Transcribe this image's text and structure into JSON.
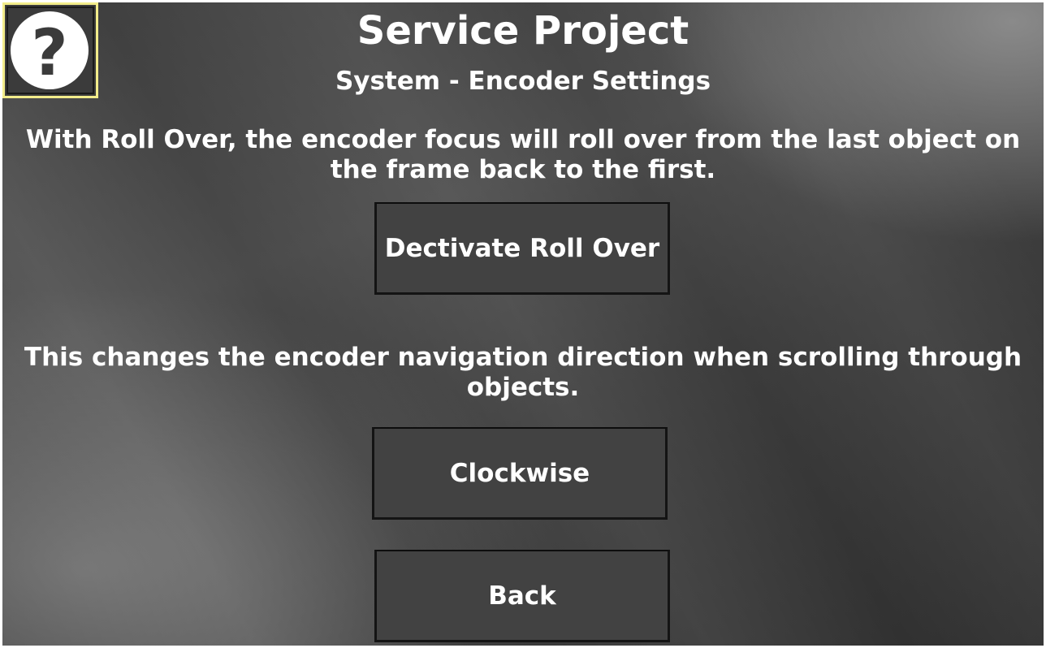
{
  "header": {
    "title": "Service Project",
    "subtitle": "System - Encoder Settings"
  },
  "help": {
    "icon": "question-mark-icon",
    "symbol": "?"
  },
  "rollover": {
    "description": "With Roll Over, the encoder focus will roll over from the last object on the frame back to the first.",
    "button_label": "Dectivate Roll Over"
  },
  "direction": {
    "description": "This changes the encoder navigation direction when scrolling through objects.",
    "button_label": "Clockwise"
  },
  "footer": {
    "back_label": "Back"
  },
  "colors": {
    "help_border": "#f2ec8a",
    "text": "#ffffff",
    "button_bg": "#424242"
  }
}
